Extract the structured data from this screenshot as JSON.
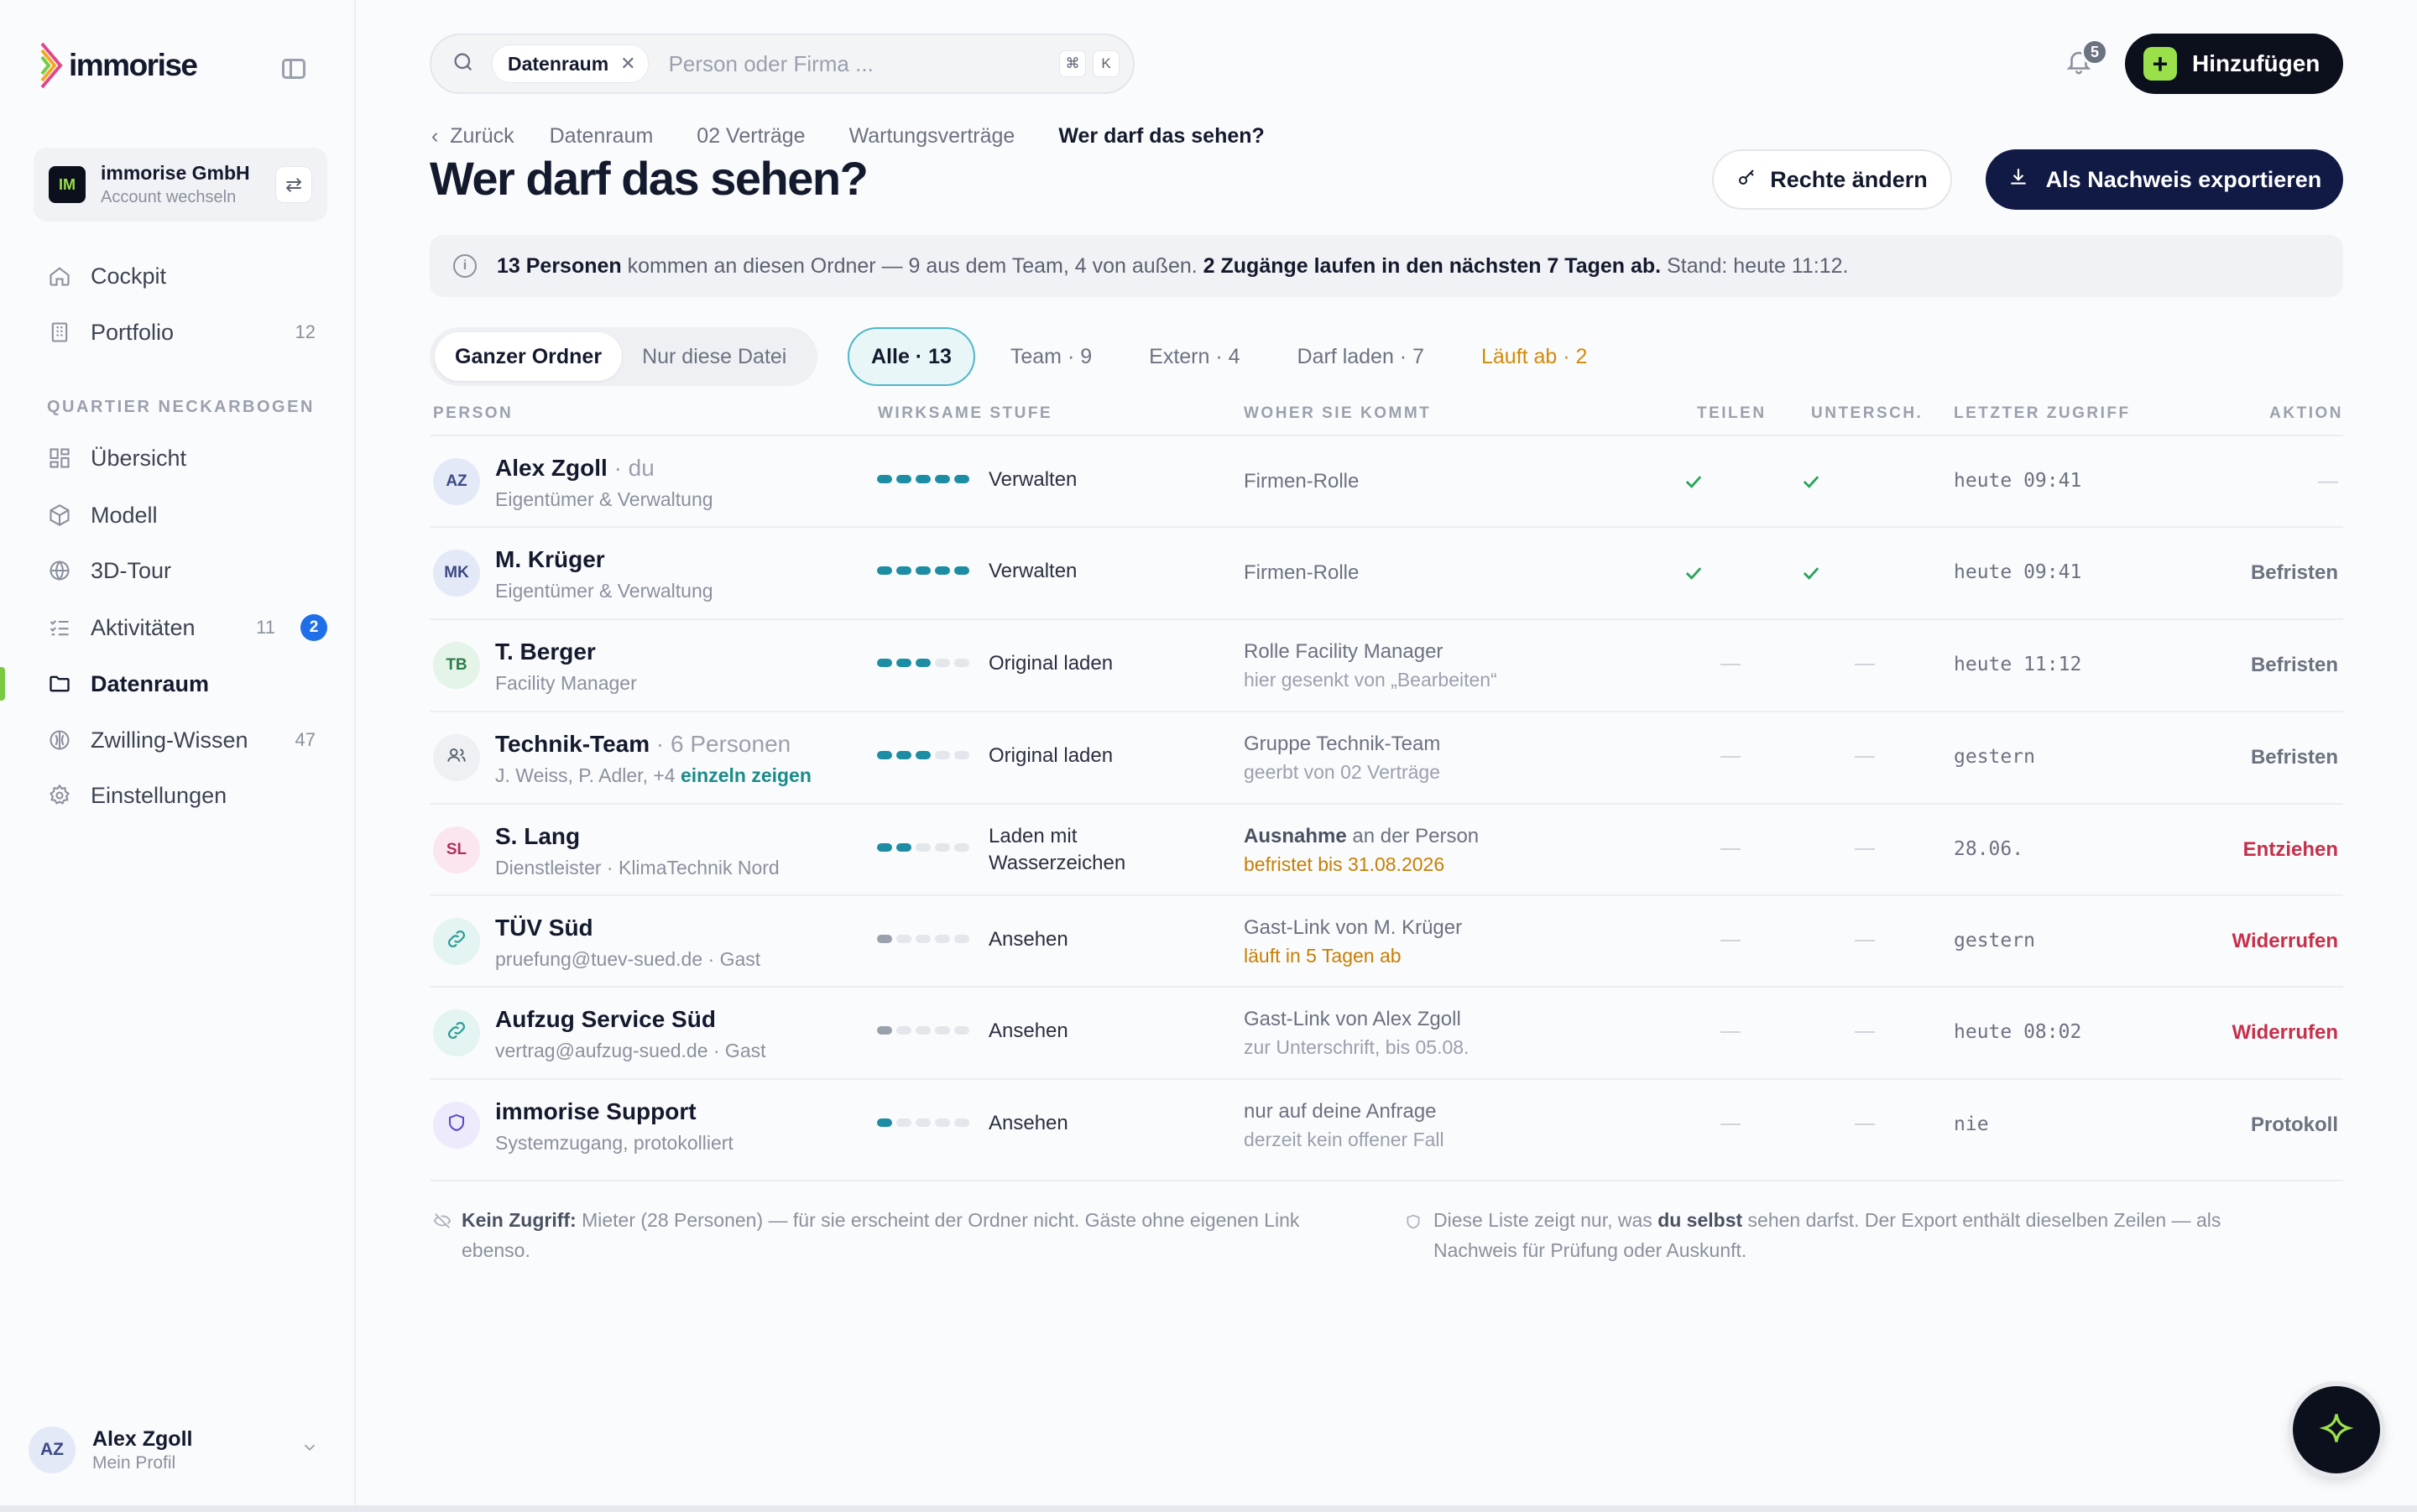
{
  "app": {
    "logo_text": "immorise"
  },
  "account": {
    "initials": "IM",
    "name": "immorise GmbH",
    "sub": "Account wechseln"
  },
  "nav": {
    "top": [
      {
        "label": "Cockpit",
        "icon": "home-icon"
      },
      {
        "label": "Portfolio",
        "count": "12",
        "icon": "building-icon"
      }
    ],
    "section_label": "QUARTIER NECKARBOGEN",
    "project": [
      {
        "label": "Übersicht",
        "icon": "grid-icon"
      },
      {
        "label": "Modell",
        "icon": "cube-icon"
      },
      {
        "label": "3D-Tour",
        "icon": "globe-icon"
      },
      {
        "label": "Aktivitäten",
        "count": "11",
        "badge": "2",
        "icon": "list-check-icon"
      },
      {
        "label": "Datenraum",
        "icon": "folder-icon",
        "active": true
      },
      {
        "label": "Zwilling-Wissen",
        "count": "47",
        "icon": "twin-icon"
      },
      {
        "label": "Einstellungen",
        "icon": "gear-icon"
      }
    ]
  },
  "profile": {
    "initials": "AZ",
    "name": "Alex Zgoll",
    "sub": "Mein Profil"
  },
  "search": {
    "chip": "Datenraum",
    "placeholder": "Person oder Firma ...",
    "kbd1": "⌘",
    "kbd2": "K"
  },
  "header": {
    "notifications": "5",
    "add_label": "Hinzufügen"
  },
  "breadcrumb": {
    "back": "Zurück",
    "items": [
      "Datenraum",
      "02 Verträge",
      "Wartungsverträge"
    ],
    "current": "Wer darf das sehen?"
  },
  "page": {
    "title": "Wer darf das sehen?",
    "btn_rights": "Rechte ändern",
    "btn_export": "Als Nachweis exportieren"
  },
  "banner": {
    "count": "13 Personen",
    "text1": " kommen an diesen Ordner — 9 aus dem Team, 4 von außen. ",
    "bold2": "2 Zugänge laufen in den nächsten 7 Tagen ab.",
    "stand": " Stand: heute 11:12."
  },
  "scope": {
    "opt1": "Ganzer Ordner",
    "opt2": "Nur diese Datei"
  },
  "filters": {
    "all": "Alle · 13",
    "team": "Team · 9",
    "extern": "Extern · 4",
    "download": "Darf laden · 7",
    "expiring": "Läuft ab · 2"
  },
  "columns": {
    "person": "PERSON",
    "level": "WIRKSAME STUFE",
    "origin": "WOHER SIE KOMMT",
    "share": "TEILEN",
    "sign": "UNTERSCH.",
    "last": "LETZTER ZUGRIFF",
    "action": "AKTION"
  },
  "rows": [
    {
      "initials": "AZ",
      "name": "Alex Zgoll",
      "suffix": " · du",
      "sub": "Eigentümer & Verwaltung",
      "level": 5,
      "level_label": "Verwalten",
      "origin": "Firmen-Rolle",
      "share": true,
      "sign": true,
      "last": "heute 09:41",
      "action": "—"
    },
    {
      "initials": "MK",
      "name": "M. Krüger",
      "suffix": "",
      "sub": "Eigentümer & Verwaltung",
      "level": 5,
      "level_label": "Verwalten",
      "origin": "Firmen-Rolle",
      "share": true,
      "sign": true,
      "last": "heute 09:41",
      "action": "Befristen"
    },
    {
      "initials": "TB",
      "name": "T. Berger",
      "suffix": "",
      "sub": "Facility Manager",
      "level": 3,
      "level_label": "Original laden",
      "origin": "Rolle Facility Manager",
      "origin2": "hier gesenkt von „Bearbeiten“",
      "share": false,
      "sign": false,
      "last": "heute 11:12",
      "action": "Befristen"
    },
    {
      "initials": "",
      "name": "Technik-Team",
      "suffix": " · 6 Personen",
      "sub": "J. Weiss, P. Adler, +4 ",
      "sub_link": "einzeln zeigen",
      "level": 3,
      "level_label": "Original laden",
      "origin": "Gruppe Technik-Team",
      "origin2": "geerbt von 02 Verträge",
      "share": false,
      "sign": false,
      "last": "gestern",
      "action": "Befristen"
    },
    {
      "initials": "SL",
      "name": "S. Lang",
      "suffix": "",
      "sub": "Dienstleister · KlimaTechnik Nord",
      "level": 2,
      "level_label_1": "Laden mit",
      "level_label_2": "Wasserzeichen",
      "origin_bold": "Ausnahme",
      "origin": " an der Person",
      "origin2": "befristet bis 31.08.2026",
      "share": false,
      "sign": false,
      "last": "28.06.",
      "action": "Entziehen"
    },
    {
      "initials": "",
      "name": "TÜV Süd",
      "suffix": "",
      "sub": "pruefung@tuev-sued.de · Gast",
      "level": 1,
      "level_label": "Ansehen",
      "origin": "Gast-Link von M. Krüger",
      "origin2": "läuft in 5 Tagen ab",
      "share": false,
      "sign": false,
      "last": "gestern",
      "action": "Widerrufen"
    },
    {
      "initials": "",
      "name": "Aufzug Service Süd",
      "suffix": "",
      "sub": "vertrag@aufzug-sued.de · Gast",
      "level": 1,
      "level_label": "Ansehen",
      "origin": "Gast-Link von Alex Zgoll",
      "origin2": "zur Unterschrift, bis 05.08.",
      "share": false,
      "sign": false,
      "last": "heute 08:02",
      "action": "Widerrufen"
    },
    {
      "initials": "",
      "name": "immorise Support",
      "suffix": "",
      "sub": "Systemzugang, protokolliert",
      "level": 1,
      "level_label": "Ansehen",
      "origin": "nur auf deine Anfrage",
      "origin2": "derzeit kein offener Fall",
      "share": false,
      "sign": false,
      "last": "nie",
      "action": "Protokoll"
    }
  ],
  "notes": {
    "left_bold": "Kein Zugriff:",
    "left_1": " Mieter (28 Personen) — für sie erscheint der Ordner nicht. Gäste ohne eigenen Link",
    "left_2": "ebenso.",
    "right_1a": "Diese Liste zeigt nur, was ",
    "right_bold": "du selbst",
    "right_1b": " sehen darfst. Der Export enthält dieselben Zeilen — als",
    "right_2": "Nachweis für Prüfung oder Auskunft."
  },
  "colors": {
    "accent_green": "#9ae04a",
    "navy": "#111a45",
    "teal": "#1c8da3",
    "red": "#c5304b",
    "amber": "#c77f05"
  }
}
